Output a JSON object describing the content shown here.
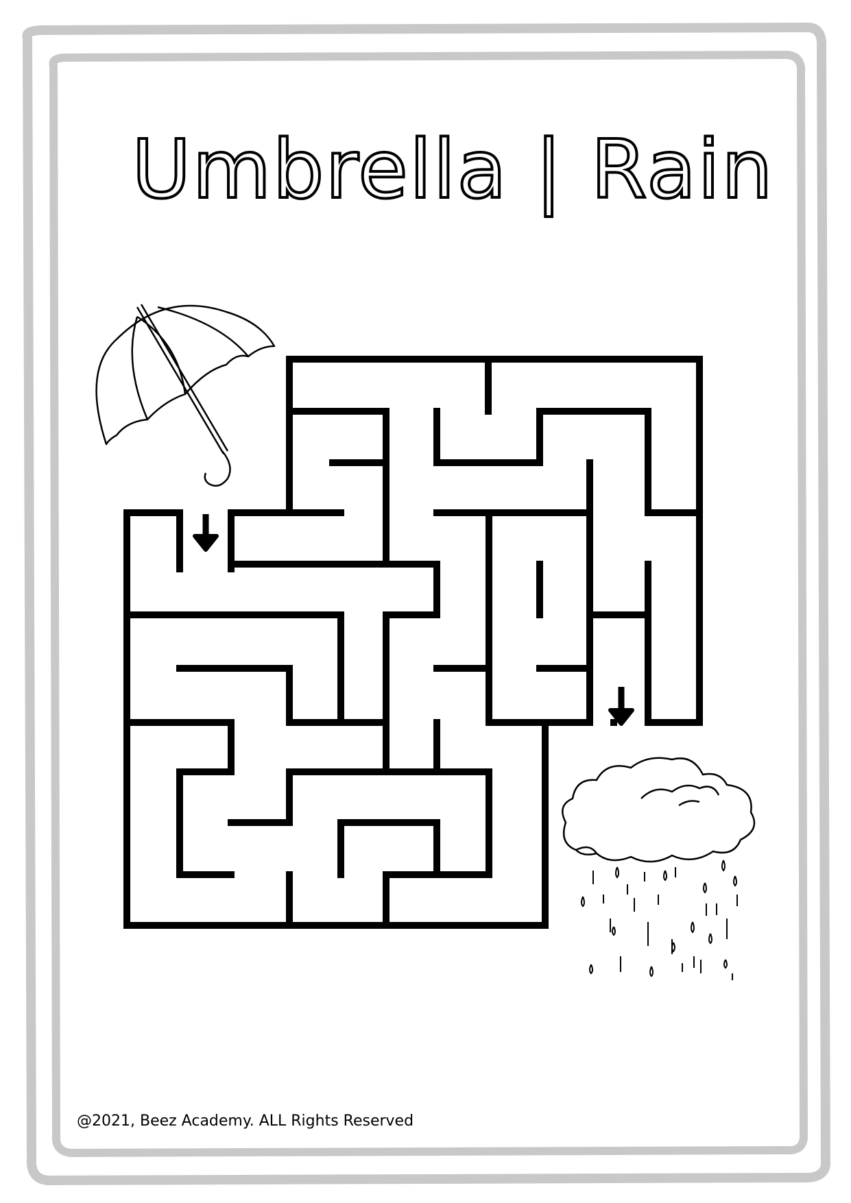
{
  "page": {
    "title": "Umbrella | Rain",
    "footer": "@2021, Beez Academy. ALL Rights Reserved"
  },
  "colors": {
    "frame": "#c8c8c8",
    "ink": "#000000",
    "paper": "#ffffff"
  },
  "icons": {
    "start": "umbrella-icon",
    "end": "rain-cloud-icon",
    "markers": "down-arrow-icon"
  }
}
